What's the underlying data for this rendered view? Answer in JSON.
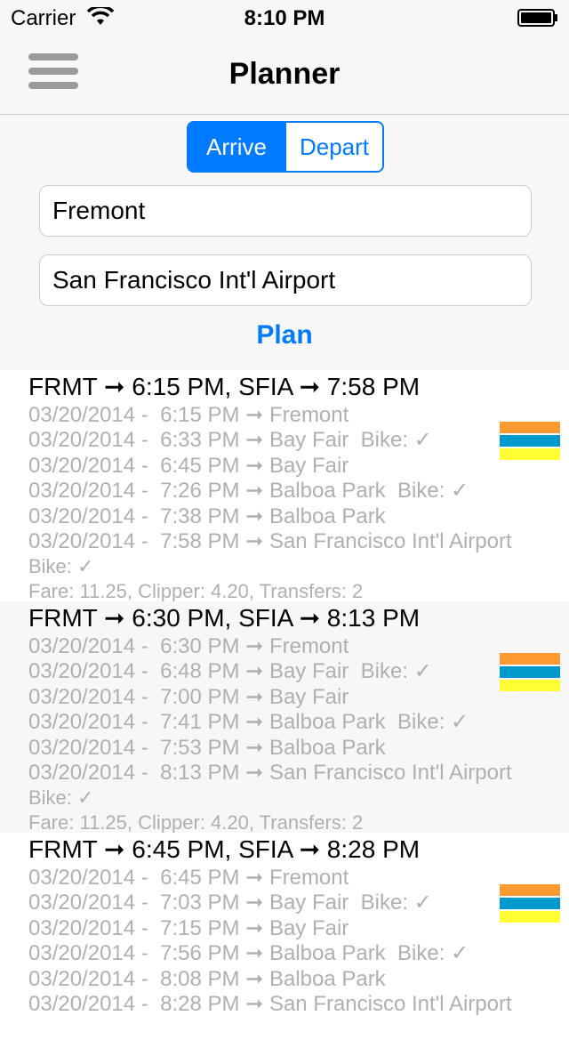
{
  "status_bar": {
    "carrier": "Carrier",
    "time": "8:10 PM"
  },
  "nav": {
    "title": "Planner"
  },
  "mode": {
    "arrive": "Arrive",
    "depart": "Depart",
    "selected": "Arrive"
  },
  "from": {
    "value": "Fremont"
  },
  "to": {
    "value": "San Francisco Int'l Airport"
  },
  "plan_label": "Plan",
  "route_colors": [
    "#ff9a33",
    "#0099cc",
    "#ffff33"
  ],
  "trips": [
    {
      "title": "FRMT ➞ 6:15 PM, SFIA ➞ 7:58 PM",
      "legs": [
        "03/20/2014 -  6:15 PM ➞ Fremont",
        "03/20/2014 -  6:33 PM ➞ Bay Fair  Bike: ✓",
        "03/20/2014 -  6:45 PM ➞ Bay Fair",
        "03/20/2014 -  7:26 PM ➞ Balboa Park  Bike: ✓",
        "03/20/2014 -  7:38 PM ➞ Balboa Park",
        "03/20/2014 -  7:58 PM ➞ San Francisco Int'l Airport"
      ],
      "extra": "Bike: ✓",
      "fare": "Fare: 11.25, Clipper: 4.20, Transfers: 2"
    },
    {
      "title": "FRMT ➞ 6:30 PM, SFIA ➞ 8:13 PM",
      "legs": [
        "03/20/2014 -  6:30 PM ➞ Fremont",
        "03/20/2014 -  6:48 PM ➞ Bay Fair  Bike: ✓",
        "03/20/2014 -  7:00 PM ➞ Bay Fair",
        "03/20/2014 -  7:41 PM ➞ Balboa Park  Bike: ✓",
        "03/20/2014 -  7:53 PM ➞ Balboa Park",
        "03/20/2014 -  8:13 PM ➞ San Francisco Int'l Airport"
      ],
      "extra": "Bike: ✓",
      "fare": "Fare: 11.25, Clipper: 4.20, Transfers: 2"
    },
    {
      "title": "FRMT ➞ 6:45 PM, SFIA ➞ 8:28 PM",
      "legs": [
        "03/20/2014 -  6:45 PM ➞ Fremont",
        "03/20/2014 -  7:03 PM ➞ Bay Fair  Bike: ✓",
        "03/20/2014 -  7:15 PM ➞ Bay Fair",
        "03/20/2014 -  7:56 PM ➞ Balboa Park  Bike: ✓",
        "03/20/2014 -  8:08 PM ➞ Balboa Park",
        "03/20/2014 -  8:28 PM ➞ San Francisco Int'l Airport"
      ],
      "extra": "",
      "fare": ""
    }
  ]
}
